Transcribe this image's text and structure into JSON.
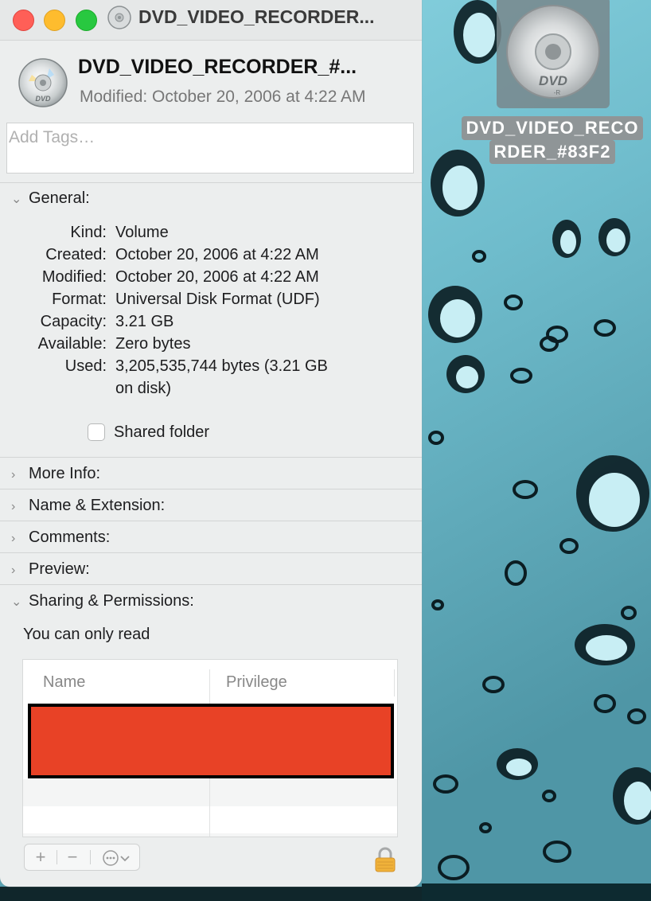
{
  "window": {
    "title": "DVD_VIDEO_RECORDER...",
    "header_name": "DVD_VIDEO_RECORDER_#...",
    "modified_line": "Modified: October 20, 2006 at 4:22 AM",
    "tags_placeholder": "Add Tags…"
  },
  "general": {
    "label": "General:",
    "rows": [
      {
        "key": "Kind:",
        "value": "Volume"
      },
      {
        "key": "Created:",
        "value": "October 20, 2006 at 4:22 AM"
      },
      {
        "key": "Modified:",
        "value": "October 20, 2006 at 4:22 AM"
      },
      {
        "key": "Format:",
        "value": "Universal Disk Format (UDF)"
      },
      {
        "key": "Capacity:",
        "value": "3.21 GB"
      },
      {
        "key": "Available:",
        "value": "Zero bytes"
      },
      {
        "key": "Used:",
        "value": "3,205,535,744 bytes (3.21 GB",
        "value2": "on disk)"
      }
    ],
    "shared_folder_label": "Shared folder",
    "shared_folder_checked": false
  },
  "sections": {
    "more_info": "More Info:",
    "name_extension": "Name & Extension:",
    "comments": "Comments:",
    "preview": "Preview:",
    "sharing": "Sharing & Permissions:"
  },
  "sharing": {
    "access_text": "You can only read",
    "col_name": "Name",
    "col_privilege": "Privilege",
    "redaction_color": "#e84226"
  },
  "toolbar": {
    "add": "+",
    "remove": "−",
    "action": "⋯"
  },
  "desktop_icon": {
    "label_line1": "DVD_VIDEO_RECO",
    "label_line2": "RDER_#83F2",
    "disc_text": "DVD",
    "disc_sub": "-R"
  },
  "colors": {
    "close": "#ff5f57",
    "minimize": "#febc2e",
    "zoom": "#28c840",
    "desktop": "#7cc8d6"
  }
}
